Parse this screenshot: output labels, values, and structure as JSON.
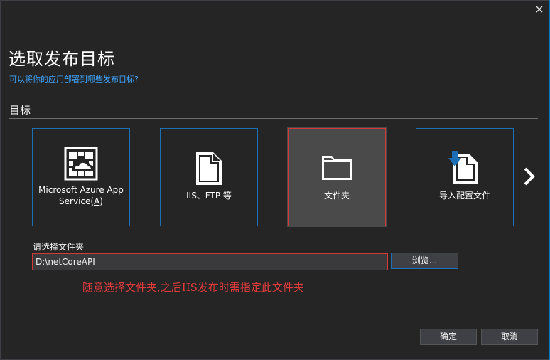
{
  "dialog": {
    "close_glyph": "×",
    "title": "选取发布目标",
    "subtitle": "可以将你的应用部署到哪些发布目标?",
    "section_label": "目标"
  },
  "targets": [
    {
      "label_line1": "Microsoft Azure App",
      "label_line2": "Service(A)",
      "icon": "azure-app-service-icon",
      "selected": false
    },
    {
      "label": "IIS、FTP 等",
      "icon": "document-icon",
      "selected": false
    },
    {
      "label": "文件夹",
      "icon": "folder-icon",
      "selected": true
    },
    {
      "label": "导入配置文件",
      "icon": "import-profile-icon",
      "selected": false
    }
  ],
  "folder": {
    "label": "请选择文件夹",
    "value": "D:\\netCoreAPI",
    "browse_label": "浏览..."
  },
  "annotation": "随意选择文件夹,之后IIS发布时需指定此文件夹",
  "footer": {
    "ok_label": "确定",
    "cancel_label": "取消"
  },
  "colors": {
    "background": "#252526",
    "accent": "#007acc",
    "tile_border": "#1c6fb5",
    "selected_tile": "#4a4a4a",
    "highlight_red": "#d23a3a",
    "link_blue": "#3ea6ff"
  }
}
